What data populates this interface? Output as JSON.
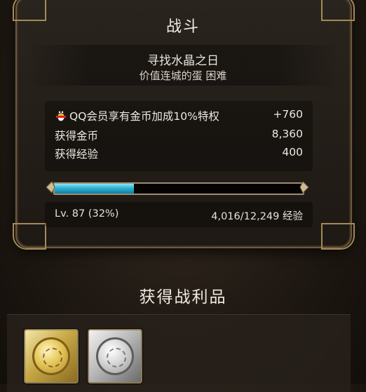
{
  "battle": {
    "title": "战斗",
    "stage_name": "寻找水晶之日",
    "stage_sub": "价值连城的蛋 困难"
  },
  "rewards": {
    "qq_bonus_label": "QQ会员享有金币加成10%特权",
    "qq_bonus_value": "+760",
    "gold_label": "获得金币",
    "gold_value": "8,360",
    "exp_label": "获得经验",
    "exp_value": "400"
  },
  "level": {
    "label": "Lv. 87 (32%)",
    "exp_text": "4,016/12,249 经验",
    "progress": 0.32
  },
  "loot": {
    "title": "获得战利品",
    "items": [
      {
        "icon": "gold-coin-card-icon"
      },
      {
        "icon": "silver-coin-card-icon"
      }
    ]
  },
  "colors": {
    "exp_bar": "#2fb3d4",
    "frame_gold": "#a58b55"
  }
}
